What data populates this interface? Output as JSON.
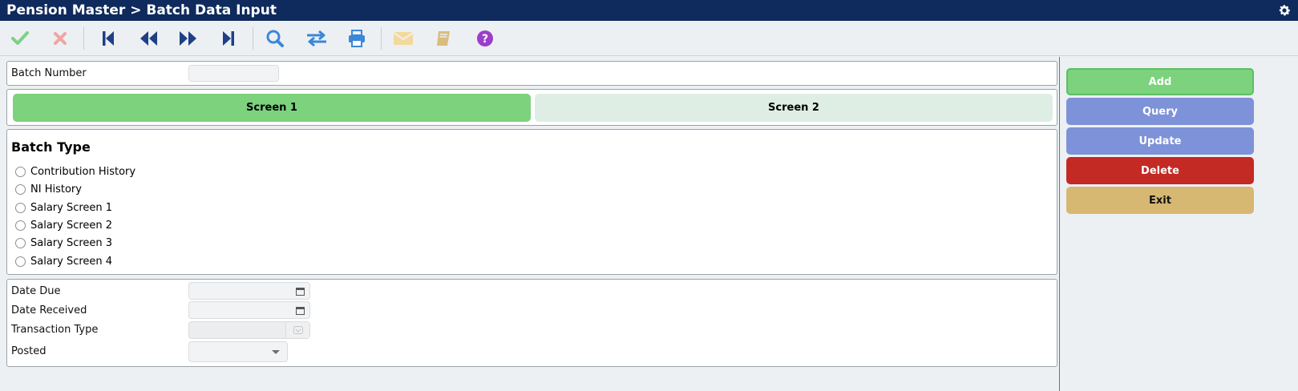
{
  "header": {
    "title": "Pension Master > Batch Data Input",
    "settings_icon": "gear-icon"
  },
  "toolbar": {
    "buttons": [
      {
        "name": "confirm",
        "icon": "check-icon",
        "color": "#7fcf86"
      },
      {
        "name": "cancel",
        "icon": "close-icon",
        "color": "#f0a5a3"
      },
      {
        "name": "first",
        "icon": "first-record-icon",
        "color": "#1f3f86"
      },
      {
        "name": "previous",
        "icon": "previous-record-icon",
        "color": "#1f3f86"
      },
      {
        "name": "next",
        "icon": "next-record-icon",
        "color": "#1f3f86"
      },
      {
        "name": "last",
        "icon": "last-record-icon",
        "color": "#1f3f86"
      },
      {
        "name": "search",
        "icon": "search-icon",
        "color": "#3b87d9"
      },
      {
        "name": "swap",
        "icon": "swap-icon",
        "color": "#3b87d9"
      },
      {
        "name": "print",
        "icon": "print-icon",
        "color": "#3b87d9"
      },
      {
        "name": "email",
        "icon": "envelope-icon",
        "color": "#f3d99a"
      },
      {
        "name": "book",
        "icon": "book-icon",
        "color": "#d9bd7c"
      },
      {
        "name": "help",
        "icon": "help-icon",
        "color": "#9b3ec9"
      }
    ]
  },
  "batch": {
    "label": "Batch Number",
    "value": ""
  },
  "tabs": [
    {
      "label": "Screen 1",
      "active": true
    },
    {
      "label": "Screen 2",
      "active": false
    }
  ],
  "batch_type": {
    "title": "Batch Type",
    "options": [
      "Contribution History",
      "NI History",
      "Salary Screen 1",
      "Salary Screen 2",
      "Salary Screen 3",
      "Salary Screen 4"
    ]
  },
  "details": {
    "date_due": {
      "label": "Date Due",
      "value": ""
    },
    "date_received": {
      "label": "Date Received",
      "value": ""
    },
    "transaction_type": {
      "label": "Transaction Type",
      "value": ""
    },
    "posted": {
      "label": "Posted",
      "value": ""
    }
  },
  "actions": {
    "add": {
      "label": "Add",
      "color": "#7cd27d"
    },
    "query": {
      "label": "Query",
      "color": "#7d92d8"
    },
    "update": {
      "label": "Update",
      "color": "#7d92d8"
    },
    "delete": {
      "label": "Delete",
      "color": "#c32a24"
    },
    "exit": {
      "label": "Exit",
      "color": "#d6b872"
    }
  }
}
